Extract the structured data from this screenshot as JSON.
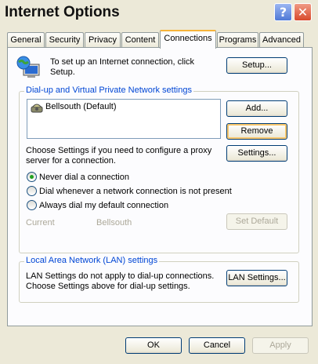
{
  "window": {
    "title": "Internet Options"
  },
  "titlebar_buttons": {
    "help": "?",
    "close": "✕"
  },
  "tabs": [
    {
      "label": "General"
    },
    {
      "label": "Security"
    },
    {
      "label": "Privacy"
    },
    {
      "label": "Content"
    },
    {
      "label": "Connections"
    },
    {
      "label": "Programs"
    },
    {
      "label": "Advanced"
    }
  ],
  "setup": {
    "text": "To set up an Internet connection, click Setup.",
    "button": "Setup..."
  },
  "dialup_group": {
    "title": "Dial-up and Virtual Private Network settings",
    "list_items": [
      {
        "label": "Bellsouth (Default)"
      }
    ],
    "add_button": "Add...",
    "remove_button": "Remove",
    "settings_text": "Choose Settings if you need to configure a proxy server for a connection.",
    "settings_button": "Settings...",
    "radios": [
      {
        "label": "Never dial a connection",
        "checked": true
      },
      {
        "label": "Dial whenever a network connection is not present",
        "checked": false
      },
      {
        "label": "Always dial my default connection",
        "checked": false
      }
    ],
    "current_label": "Current",
    "current_value": "Bellsouth",
    "set_default_button": "Set Default"
  },
  "lan_group": {
    "title": "Local Area Network (LAN) settings",
    "text": "LAN Settings do not apply to dial-up connections. Choose Settings above for dial-up settings.",
    "button": "LAN Settings..."
  },
  "footer": {
    "ok": "OK",
    "cancel": "Cancel",
    "apply": "Apply"
  }
}
